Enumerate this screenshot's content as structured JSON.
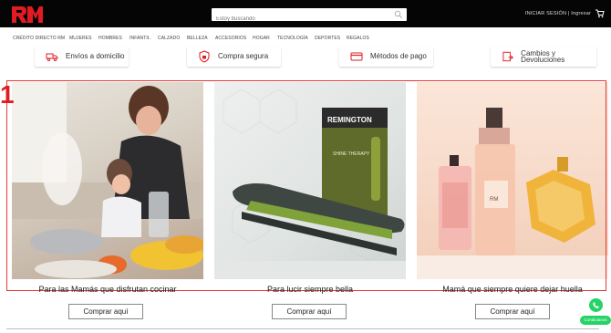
{
  "header": {
    "logo_text": "RM",
    "search_placeholder": "Estoy buscando",
    "login_text": "INICIAR SESIÓN | Ingresar"
  },
  "nav": {
    "items": [
      "CRÉDITO DIRECTO RM",
      "MUJERES",
      "HOMBRES",
      "INFANTIL",
      "CALZADO",
      "BELLEZA",
      "ACCESORIOS",
      "HOGAR",
      "TECNOLOGÍA",
      "DEPORTES",
      "REGALOS"
    ]
  },
  "benefits": [
    {
      "label": "Envíos a domicilio",
      "icon": "truck-icon"
    },
    {
      "label": "Compra segura",
      "icon": "shield-lock-icon"
    },
    {
      "label": "Métodos de pago",
      "icon": "credit-card-icon"
    },
    {
      "label": "Cambios y Devoluciones",
      "icon": "exchange-icon"
    }
  ],
  "promo": {
    "marker": "1",
    "cards": [
      {
        "caption": "Para las Mamás que disfrutan cocinar",
        "button": "Comprar aquí"
      },
      {
        "caption": "Para lucir siempre bella",
        "button": "Comprar aquí"
      },
      {
        "caption": "Mamá que siempre quiere dejar huella",
        "button": "Comprar aquí"
      }
    ],
    "product_brand": "REMINGTON",
    "product_box_text": "SHINE THERAPY",
    "perfume_label": "RM"
  },
  "whatsapp": {
    "label": "Contáctanos",
    "icon": "whatsapp-icon"
  },
  "colors": {
    "brand_red": "#e01b22",
    "topbar": "#050505",
    "whatsapp_green": "#25d366",
    "frame": "#e53935"
  }
}
